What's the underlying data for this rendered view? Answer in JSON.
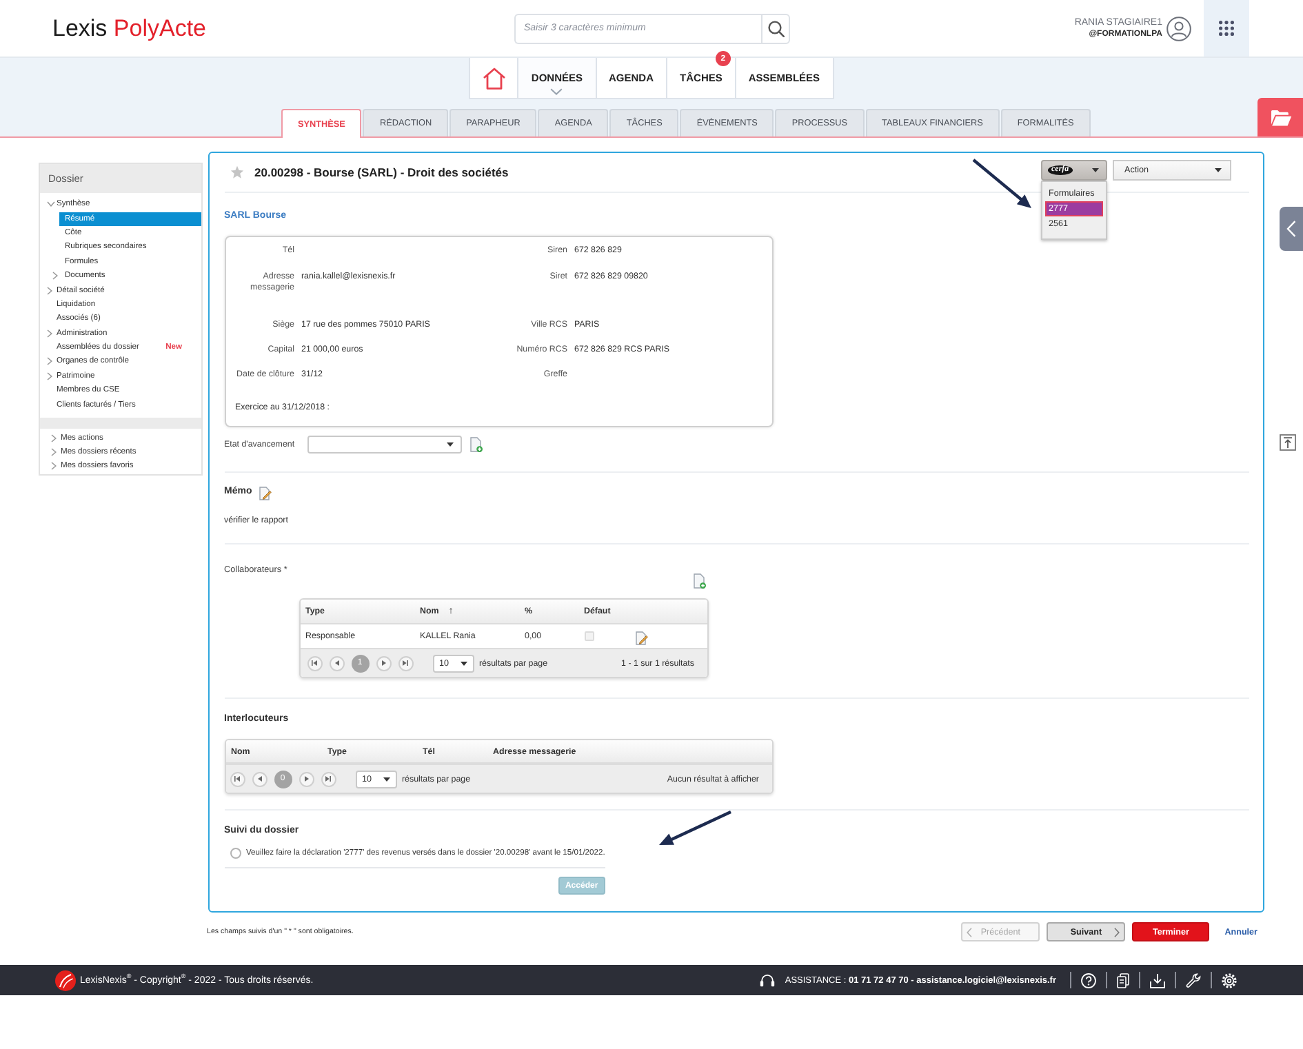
{
  "header": {
    "logo": {
      "first": "Lexis",
      "second": "PolyActe"
    },
    "search": {
      "placeholder": "Saisir 3 caractères minimum"
    },
    "user": {
      "name": "RANIA STAGIAIRE1",
      "account": "@FORMATIONLPA"
    }
  },
  "main_nav": [
    {
      "kind": "home",
      "selected": false
    },
    {
      "kind": "link",
      "label": "DONNÉES",
      "selected": true
    },
    {
      "kind": "link",
      "label": "AGENDA",
      "selected": false
    },
    {
      "kind": "link",
      "label": "TÂCHES",
      "selected": false,
      "badge": "2"
    },
    {
      "kind": "link",
      "label": "ASSEMBLÉES",
      "selected": false
    }
  ],
  "tabs": [
    {
      "label": "SYNTHÈSE",
      "selected": true
    },
    {
      "label": "RÉDACTION",
      "selected": false
    },
    {
      "label": "PARAPHEUR",
      "selected": false
    },
    {
      "label": "AGENDA",
      "selected": false
    },
    {
      "label": "TÂCHES",
      "selected": false
    },
    {
      "label": "ÉVÈNEMENTS",
      "selected": false
    },
    {
      "label": "PROCESSUS",
      "selected": false
    },
    {
      "label": "TABLEAUX FINANCIERS",
      "selected": false
    },
    {
      "label": "FORMALITÉS",
      "selected": false
    }
  ],
  "sidebar": {
    "title": "Dossier",
    "items": [
      {
        "label": "Synthèse",
        "selected": false,
        "expanded": true,
        "children": [
          {
            "label": "Résumé",
            "selected": true
          },
          {
            "label": "Côte",
            "selected": false
          },
          {
            "label": "Rubriques secondaires",
            "selected": false
          },
          {
            "label": "Formules",
            "selected": false
          },
          {
            "label": "Documents",
            "selected": false,
            "expanded": false
          }
        ]
      },
      {
        "label": "Détail société",
        "selected": false,
        "expanded": false
      },
      {
        "label": "Liquidation",
        "selected": false
      },
      {
        "label": "Associés (6)",
        "selected": false
      },
      {
        "label": "Administration",
        "selected": false,
        "expanded": false
      },
      {
        "label": "Assemblées du dossier",
        "selected": false,
        "badge": "New"
      },
      {
        "label": "Organes de contrôle",
        "selected": false,
        "expanded": false
      },
      {
        "label": "Patrimoine",
        "selected": false,
        "expanded": false
      },
      {
        "label": "Membres du CSE",
        "selected": false
      },
      {
        "label": "Clients facturés / Tiers",
        "selected": false
      }
    ],
    "links": [
      {
        "label": "Mes actions",
        "expanded": false
      },
      {
        "label": "Mes dossiers récents",
        "expanded": false
      },
      {
        "label": "Mes dossiers favoris",
        "expanded": false
      }
    ]
  },
  "dossier": {
    "title": "20.00298 - Bourse (SARL) - Droit des sociétés",
    "starred": false,
    "forms_menu": {
      "logo": "cerfa",
      "expanded": true,
      "items": [
        {
          "label": "Formulaires",
          "selected": false
        },
        {
          "label": "2777",
          "selected": true
        },
        {
          "label": "2561",
          "selected": false
        }
      ]
    },
    "action_select": {
      "value": "Action"
    },
    "company": {
      "name": "SARL Bourse",
      "rows": [
        {
          "left": {
            "label": "Tél"
          },
          "right": {
            "label": "Siren",
            "value": "672 826 829"
          }
        },
        {
          "left": {
            "label": "Adresse messagerie",
            "value": "rania.kallel@lexisnexis.fr"
          },
          "right": {
            "label": "Siret",
            "value": "672 826 829 09820"
          }
        },
        {
          "left": {
            "label": "Siège",
            "value": "17 rue des pommes 75010 PARIS"
          },
          "right": {
            "label": "Ville RCS",
            "value": "PARIS"
          }
        },
        {
          "left": {
            "label": "Capital",
            "value": "21 000,00 euros"
          },
          "right": {
            "label": "Numéro RCS",
            "value": "672 826 829 RCS PARIS"
          }
        },
        {
          "left": {
            "label": "Date de clôture",
            "value": "31/12"
          },
          "right": {
            "label": "Greffe"
          }
        }
      ],
      "exercise": "Exercice au 31/12/2018 :"
    },
    "progress": {
      "label": "Etat d'avancement"
    },
    "memo": {
      "title": "Mémo",
      "text": "vérifier le rapport"
    },
    "collaborators": {
      "title": "Collaborateurs *",
      "columns": [
        {
          "label": "Type"
        },
        {
          "label": "Nom",
          "sort_mark": "↑"
        },
        {
          "label": "%"
        },
        {
          "label": "Défaut"
        }
      ],
      "rows": [
        {
          "type": "Responsable",
          "name": "KALLEL Rania",
          "percent": "0,00",
          "default": {
            "checked": false,
            "disabled": true
          }
        }
      ],
      "pager": {
        "page": "1",
        "page_size": "10",
        "page_size_label": "résultats par page",
        "summary": "1 - 1 sur 1 résultats"
      }
    },
    "interlocutors": {
      "title": "Interlocuteurs",
      "columns": [
        {
          "label": "Nom"
        },
        {
          "label": "Type"
        },
        {
          "label": "Tél"
        },
        {
          "label": "Adresse messagerie"
        }
      ],
      "pager": {
        "page": "0",
        "page_size": "10",
        "page_size_label": "résultats par page",
        "summary": "Aucun résultat à afficher"
      }
    },
    "follow_up": {
      "title": "Suivi du dossier",
      "tasks": [
        {
          "text": "Veuillez faire la déclaration '2777' des revenus versés dans le dossier '20.00298' avant le 15/01/2022.",
          "selected": false
        }
      ],
      "button": {
        "label": "Accéder",
        "disabled": true
      }
    }
  },
  "required_note": "Les champs suivis d'un \" * \" sont obligatoires.",
  "wizard_buttons": [
    {
      "kind": "previous",
      "label": "Précédent",
      "disabled": true
    },
    {
      "kind": "next",
      "label": "Suivant",
      "disabled": false
    },
    {
      "kind": "finish",
      "label": "Terminer",
      "disabled": false
    },
    {
      "kind": "cancel",
      "label": "Annuler",
      "disabled": false
    }
  ],
  "footer": {
    "copyright": "LexisNexis$^{®}$ - Copyright$^{®}$ - 2022 - Tous droits réservés.",
    "assistance": "ASSISTANCE : **01 71 72 47 70 - assistance.logiciel@lexisnexis.fr**"
  }
}
